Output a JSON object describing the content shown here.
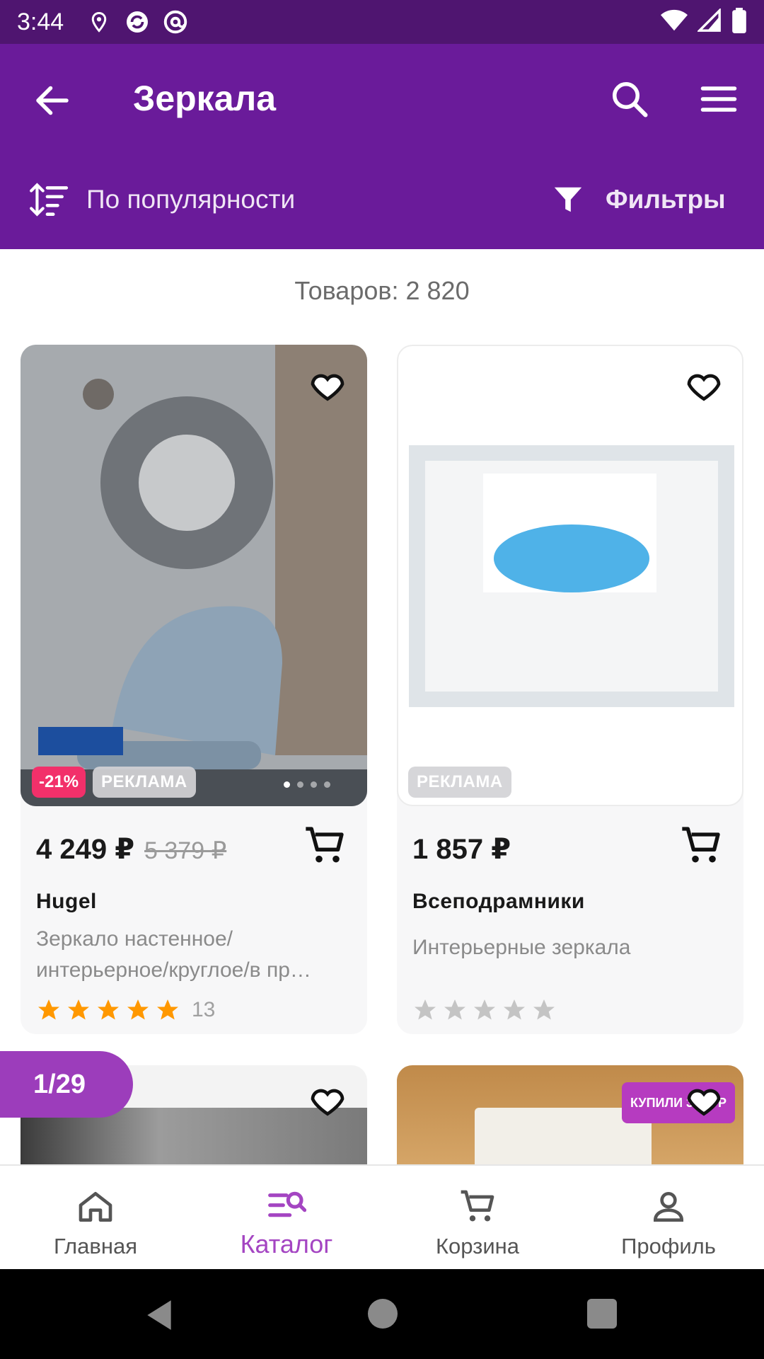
{
  "status_bar": {
    "time": "3:44"
  },
  "header": {
    "title": "Зеркала",
    "sort_label": "По популярности",
    "filter_label": "Фильтры"
  },
  "catalog": {
    "count_text": "Товаров: 2 820"
  },
  "products": [
    {
      "price": "4 249 ₽",
      "old_price": "5 379 ₽",
      "discount": "-21%",
      "ad_badge": "РЕКЛАМА",
      "brand": "Hugel",
      "description": "Зеркало настенное/ интерьерное/круглое/в пр…",
      "rating": 5,
      "review_count": "13"
    },
    {
      "price": "1 857 ₽",
      "ad_badge": "РЕКЛАМА",
      "brand": "Всеподрамники",
      "description": "Интерьерные зеркала",
      "rating": 0
    }
  ],
  "promo_badge": "КУПИЛИ 3000 Р",
  "page_indicator": "1/29",
  "bottom_nav": {
    "items": [
      {
        "label": "Главная",
        "icon": "home-icon"
      },
      {
        "label": "Каталог",
        "icon": "catalog-search-icon",
        "active": true
      },
      {
        "label": "Корзина",
        "icon": "cart-icon"
      },
      {
        "label": "Профиль",
        "icon": "profile-icon"
      }
    ]
  },
  "colors": {
    "primary": "#6a1b9a",
    "status_bar": "#4f1570",
    "accent": "#a445c2",
    "discount": "#f2306a",
    "star": "#ff9800"
  }
}
